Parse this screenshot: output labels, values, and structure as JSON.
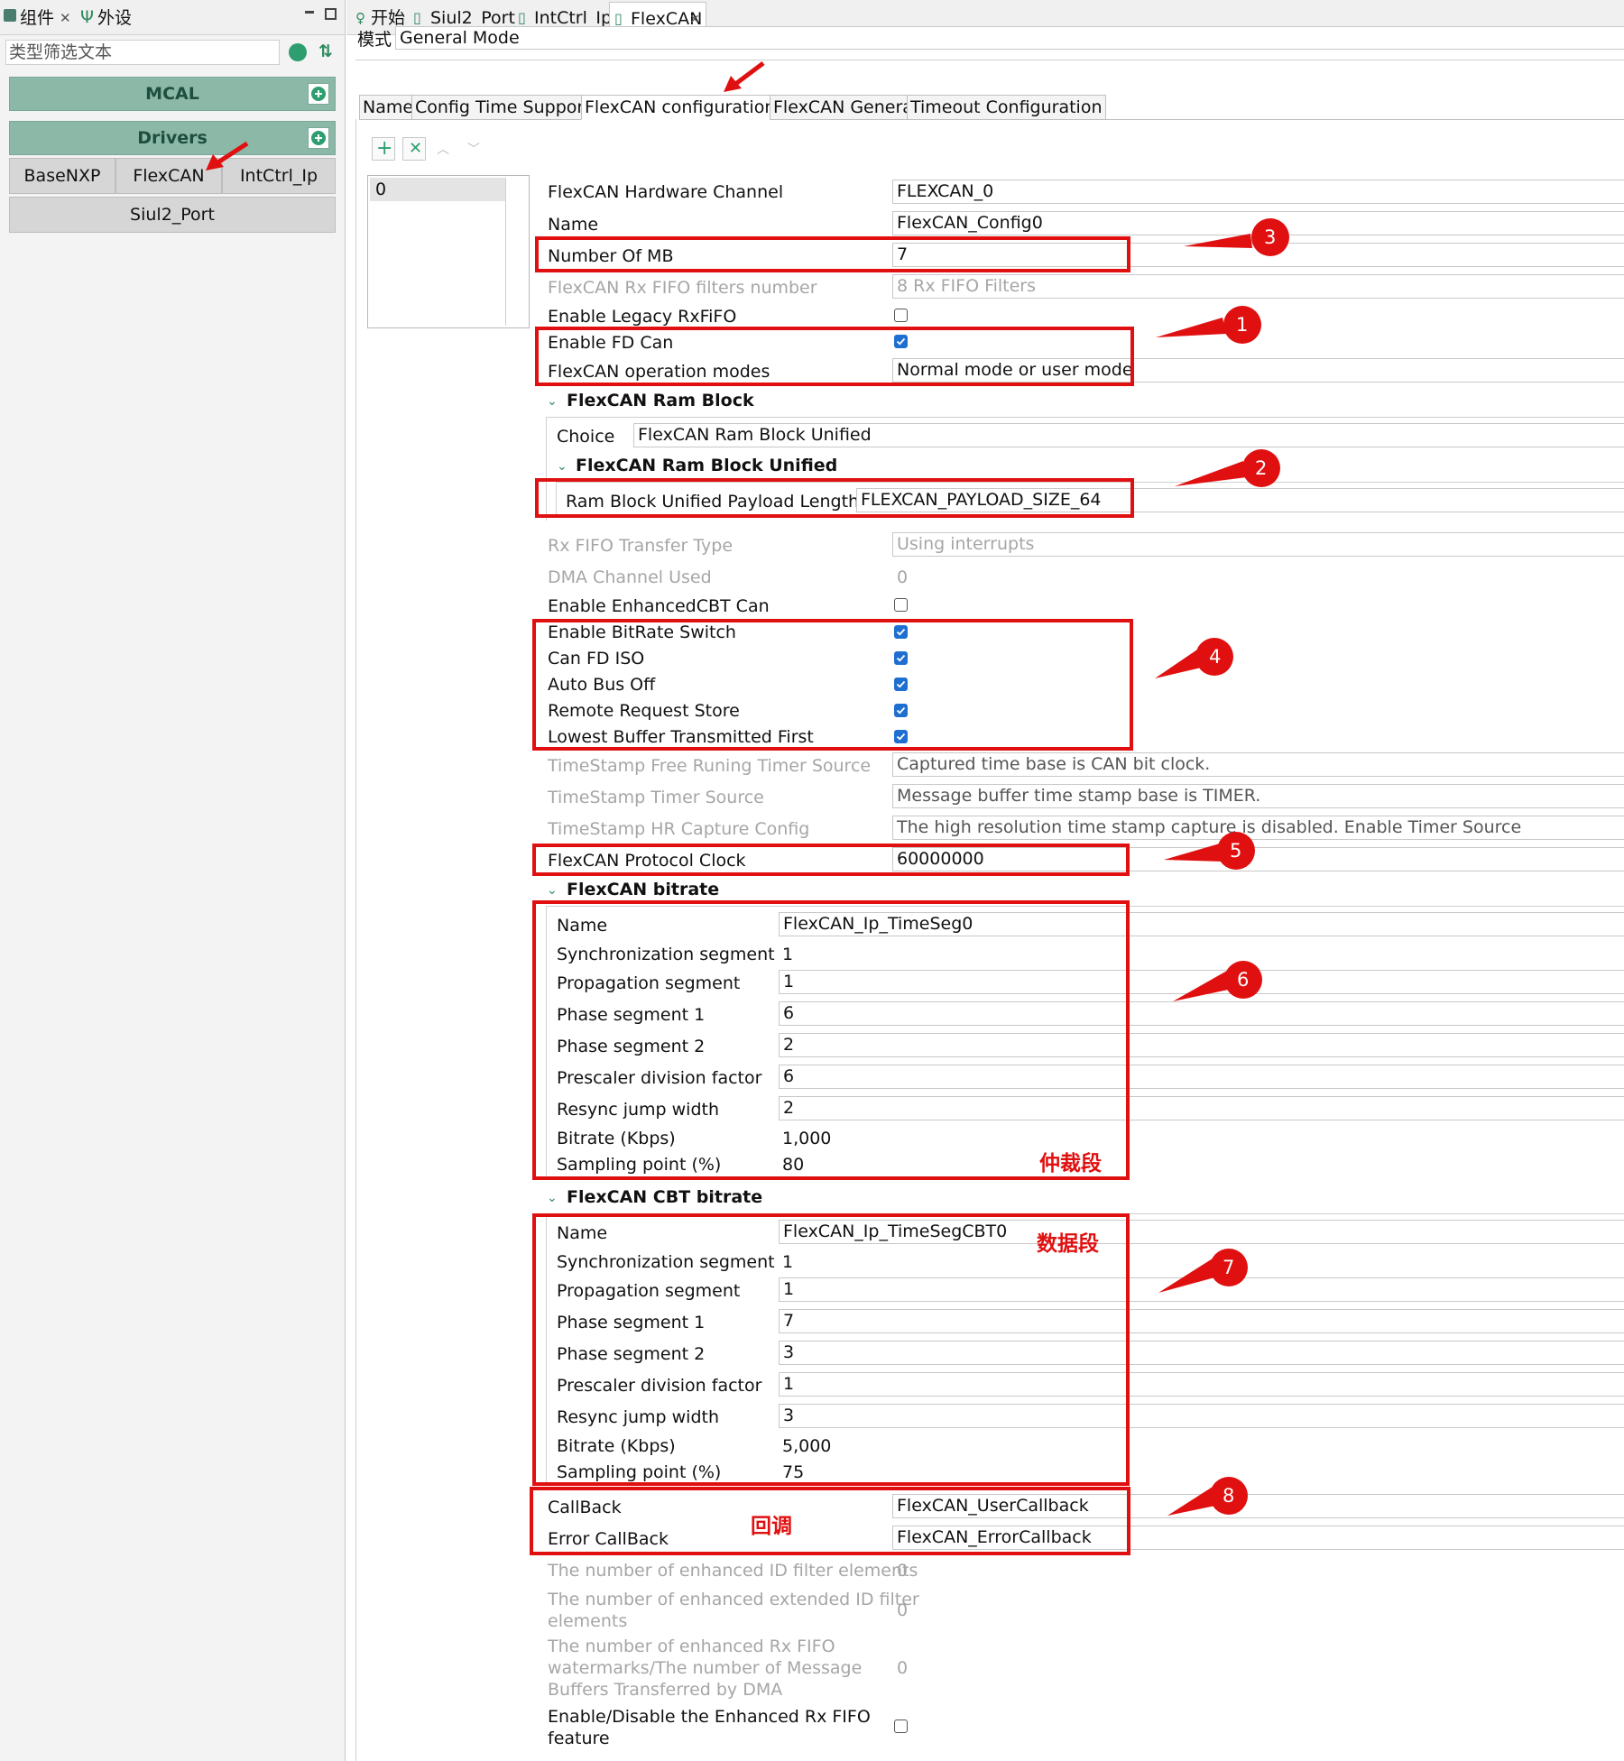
{
  "left_panel": {
    "tabs": [
      {
        "label": "组件"
      },
      {
        "label": "外设"
      }
    ],
    "filter_placeholder": "类型筛选文本",
    "groups": {
      "mcal": "MCAL",
      "drivers": "Drivers"
    },
    "drivers": [
      "BaseNXP",
      "FlexCAN",
      "IntCtrl_Ip",
      "Siul2_Port"
    ]
  },
  "editor_tabs": [
    "开始",
    "Siul2_Port",
    "IntCtrl_Ip",
    "FlexCAN"
  ],
  "mode": {
    "label": "模式",
    "value": "General Mode"
  },
  "config_tabs": [
    "Name",
    "Config Time Support",
    "FlexCAN configurations",
    "FlexCAN General",
    "Timeout Configuration"
  ],
  "list_items": [
    "0"
  ],
  "props": {
    "hw_channel": {
      "label": "FlexCAN Hardware Channel",
      "value": "FLEXCAN_0"
    },
    "name": {
      "label": "Name",
      "value": "FlexCAN_Config0"
    },
    "num_mb": {
      "label": "Number Of MB",
      "value": "7"
    },
    "rx_fifo_filters": {
      "label": "FlexCAN Rx FIFO filters number",
      "value": "8 Rx FIFO Filters"
    },
    "legacy_rxfifo": {
      "label": "Enable Legacy RxFiFO"
    },
    "fd_can": {
      "label": "Enable FD Can"
    },
    "op_modes": {
      "label": "FlexCAN operation modes",
      "value": "Normal mode or user mode"
    },
    "ram_block": {
      "title": "FlexCAN Ram Block",
      "choice_label": "Choice",
      "choice_value": "FlexCAN Ram Block Unified",
      "unified_title": "FlexCAN Ram Block Unified",
      "payload_label": "Ram Block Unified Payload Length",
      "payload_value": "FLEXCAN_PAYLOAD_SIZE_64"
    },
    "rx_fifo_transfer": {
      "label": "Rx FIFO Transfer Type",
      "value": "Using interrupts"
    },
    "dma_channel": {
      "label": "DMA Channel Used",
      "value": "0"
    },
    "enhanced_cbt": {
      "label": "Enable EnhancedCBT Can"
    },
    "bitrate_switch": {
      "label": "Enable BitRate Switch"
    },
    "can_fd_iso": {
      "label": "Can FD ISO"
    },
    "auto_bus_off": {
      "label": "Auto Bus Off"
    },
    "remote_request": {
      "label": "Remote Request Store"
    },
    "lowest_buffer": {
      "label": "Lowest Buffer Transmitted First"
    },
    "ts_free_timer": {
      "label": "TimeStamp Free Runing Timer Source",
      "value": "Captured time base is CAN bit clock."
    },
    "ts_timer": {
      "label": "TimeStamp Timer Source",
      "value": "Message buffer time stamp base is TIMER."
    },
    "ts_hr": {
      "label": "TimeStamp HR Capture Config",
      "value": "The high resolution time stamp capture is disabled. Enable Timer Source"
    },
    "protocol_clock": {
      "label": "FlexCAN Protocol Clock",
      "value": "60000000"
    },
    "bitrate": {
      "title": "FlexCAN bitrate",
      "rows": [
        {
          "label": "Name",
          "value": "FlexCAN_Ip_TimeSeg0"
        },
        {
          "label": "Synchronization segment",
          "value": "1"
        },
        {
          "label": "Propagation segment",
          "value": "1"
        },
        {
          "label": "Phase segment 1",
          "value": "6"
        },
        {
          "label": "Phase segment 2",
          "value": "2"
        },
        {
          "label": "Prescaler division factor",
          "value": "6"
        },
        {
          "label": "Resync jump width",
          "value": "2"
        },
        {
          "label": "Bitrate (Kbps)",
          "value": "1,000"
        },
        {
          "label": "Sampling point (%)",
          "value": "80"
        }
      ]
    },
    "cbt_bitrate": {
      "title": "FlexCAN CBT bitrate",
      "rows": [
        {
          "label": "Name",
          "value": "FlexCAN_Ip_TimeSegCBT0"
        },
        {
          "label": "Synchronization segment",
          "value": "1"
        },
        {
          "label": "Propagation segment",
          "value": "1"
        },
        {
          "label": "Phase segment 1",
          "value": "7"
        },
        {
          "label": "Phase segment 2",
          "value": "3"
        },
        {
          "label": "Prescaler division factor",
          "value": "1"
        },
        {
          "label": "Resync jump width",
          "value": "3"
        },
        {
          "label": "Bitrate (Kbps)",
          "value": "5,000"
        },
        {
          "label": "Sampling point (%)",
          "value": "75"
        }
      ]
    },
    "callback": {
      "label": "CallBack",
      "value": "FlexCAN_UserCallback"
    },
    "error_callback": {
      "label": "Error CallBack",
      "value": "FlexCAN_ErrorCallback"
    },
    "enh_id_filter": {
      "label": "The number of enhanced ID filter elements",
      "value": "0"
    },
    "enh_ext_id_filter": {
      "label1": "The number of enhanced extended ID filter",
      "label2": "elements",
      "value": "0"
    },
    "enh_rx_fifo_wm": {
      "label1": "The number of enhanced Rx FIFO",
      "label2": "watermarks/The number of Message",
      "label3": "Buffers Transferred by DMA",
      "value": "0"
    },
    "enh_rx_fifo_en": {
      "label1": "Enable/Disable the Enhanced Rx FIFO",
      "label2": "feature"
    }
  },
  "annotations": {
    "numbers": [
      "1",
      "2",
      "3",
      "4",
      "5",
      "6",
      "7",
      "8"
    ],
    "arbitration": "仲裁段",
    "data_phase": "数据段",
    "callback": "回调"
  },
  "colors": {
    "accent_red": "#e01010",
    "group_green": "#8cb8a8",
    "check_blue": "#1f6fd1"
  }
}
